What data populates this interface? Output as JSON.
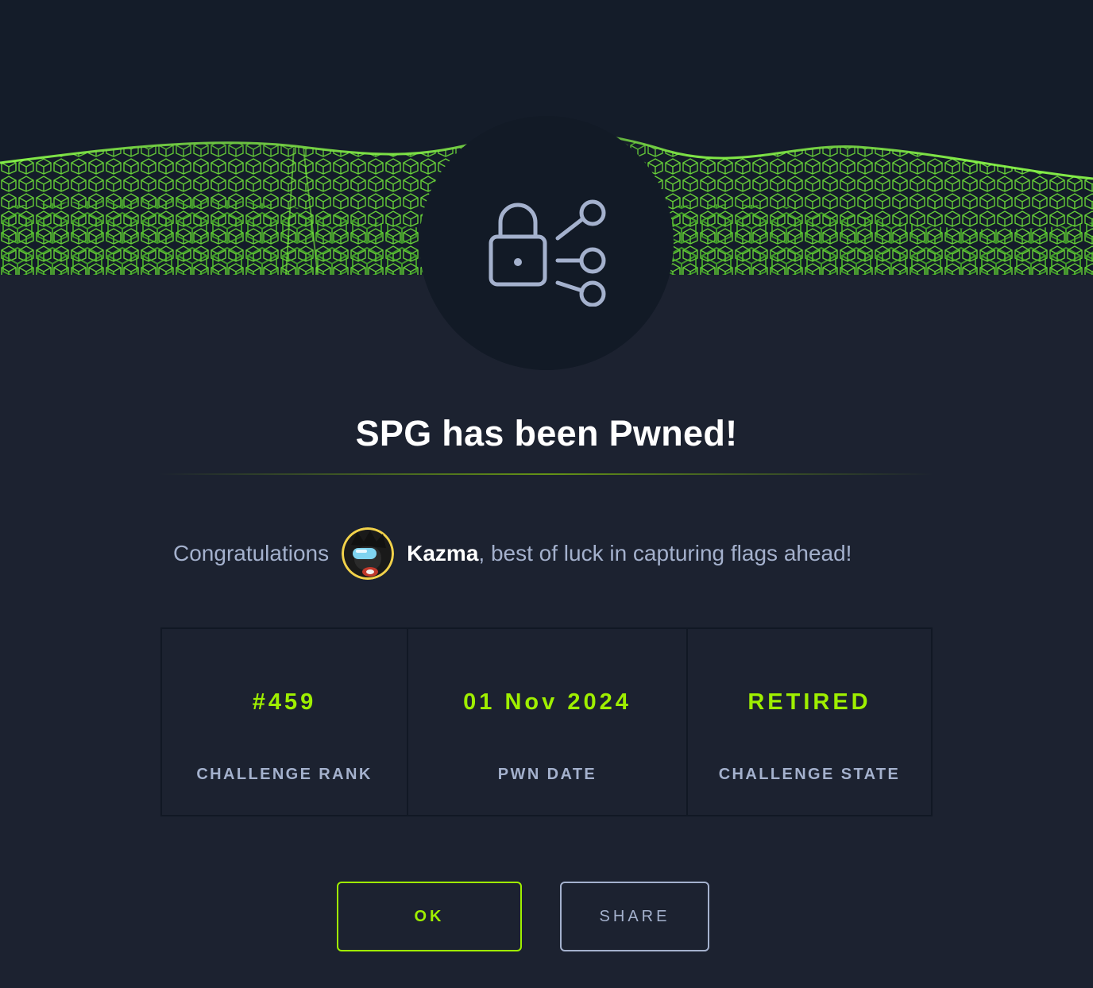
{
  "dialog": {
    "title": "SPG has been Pwned!",
    "congrats": {
      "prefix": "Congratulations",
      "username": "Kazma",
      "suffix": ", best of luck in capturing flags ahead!"
    },
    "stats": [
      {
        "value": "#459",
        "label": "CHALLENGE RANK"
      },
      {
        "value": "01 Nov 2024",
        "label": "PWN DATE"
      },
      {
        "value": "RETIRED",
        "label": "CHALLENGE STATE"
      }
    ],
    "buttons": {
      "ok": "OK",
      "share": "SHARE"
    }
  },
  "icons": {
    "challenge_category": "lock-share-icon",
    "user_avatar": "avatar"
  },
  "colors": {
    "background": "#1c2230",
    "accent": "#9fef00",
    "muted_text": "#a4b1cd",
    "heading": "#ffffff"
  }
}
